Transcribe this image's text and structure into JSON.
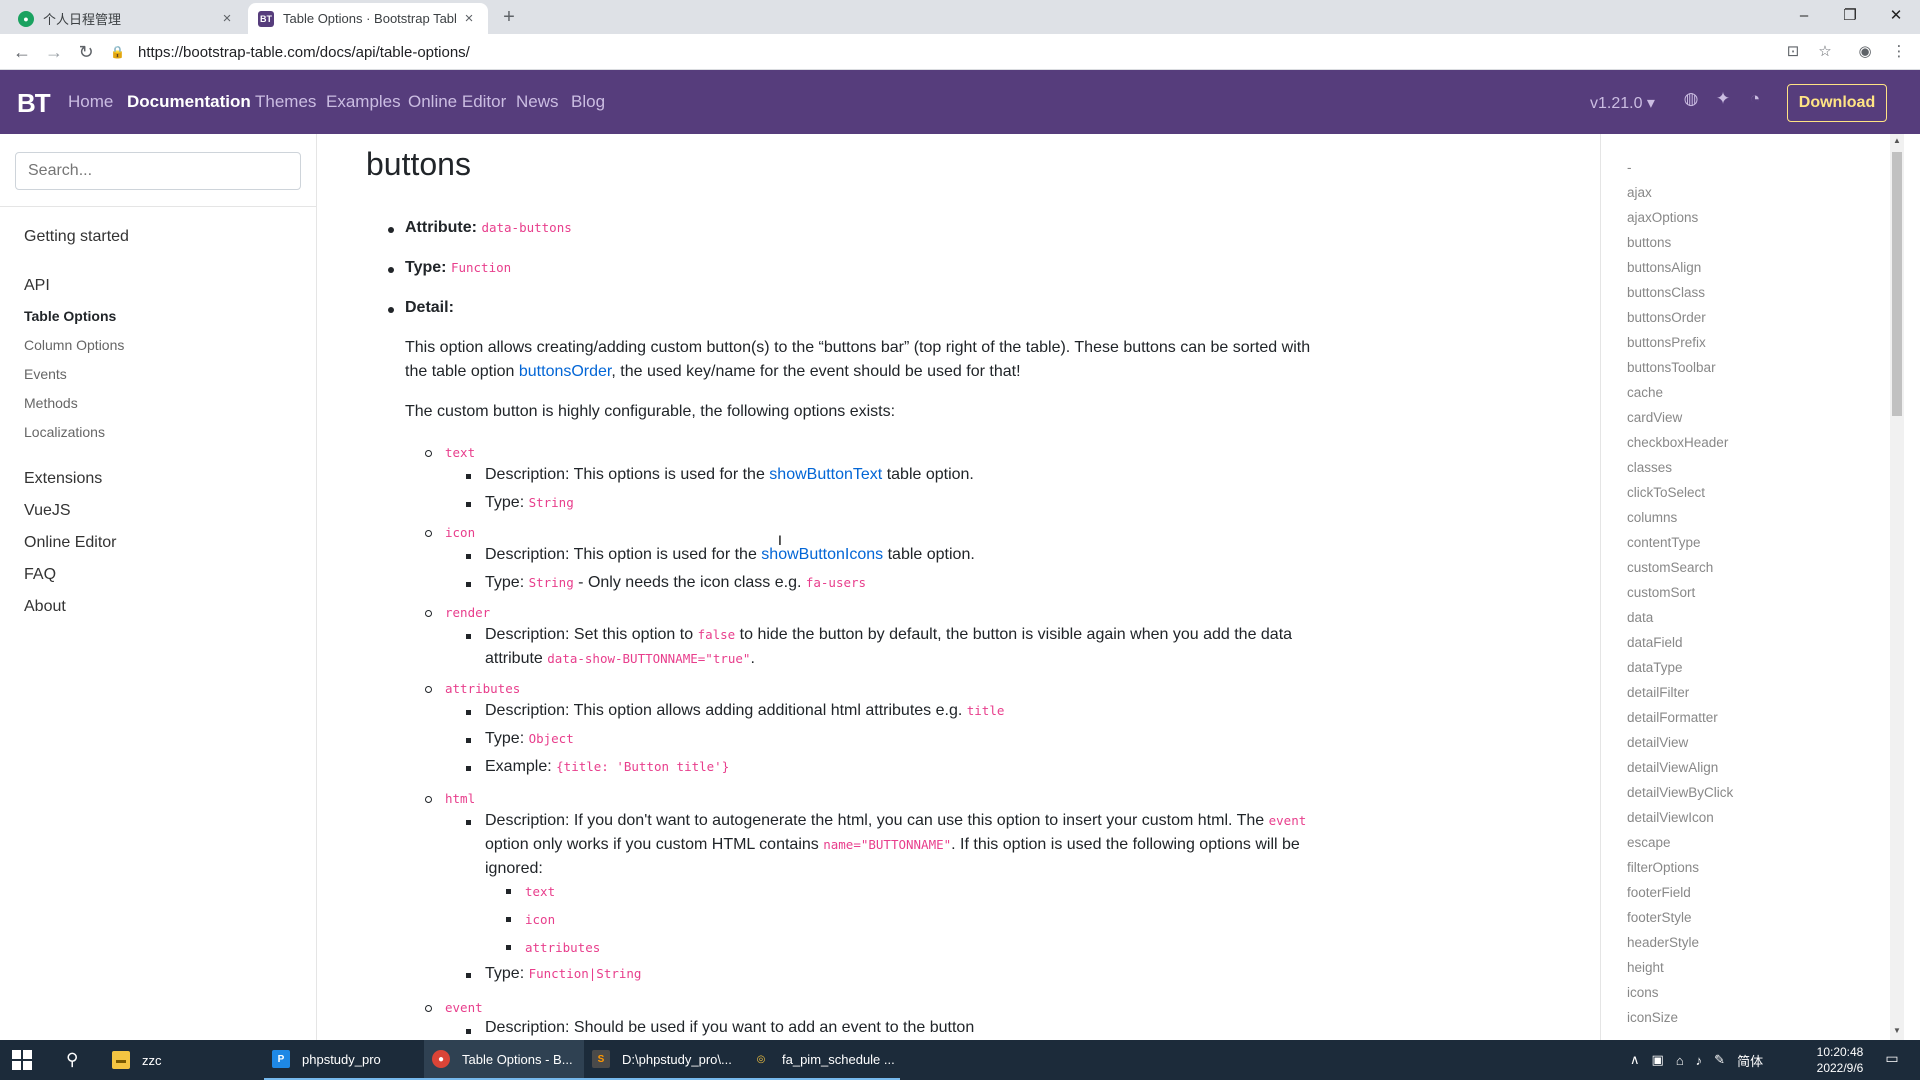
{
  "browser": {
    "tabs": [
      {
        "title": "个人日程管理",
        "close": "×"
      },
      {
        "title": "Table Options · Bootstrap Tabl",
        "close": "×"
      }
    ],
    "new_tab": "+",
    "url": "https://bootstrap-table.com/docs/api/table-options/",
    "window_controls": {
      "minimize": "–",
      "restore": "❐",
      "close": "✕"
    }
  },
  "navbar": {
    "brand": "BT",
    "links": [
      "Home",
      "Documentation",
      "Themes",
      "Examples",
      "Online Editor",
      "News",
      "Blog"
    ],
    "current_link": "Documentation",
    "version": "v1.21.0 ▾",
    "download": "Download"
  },
  "sidebar": {
    "search_placeholder": "Search...",
    "getting_started": "Getting started",
    "api": "API",
    "api_items": [
      "Table Options",
      "Column Options",
      "Events",
      "Methods",
      "Localizations"
    ],
    "groups": [
      "Extensions",
      "VueJS",
      "Online Editor",
      "FAQ",
      "About"
    ]
  },
  "content": {
    "title": "buttons",
    "attribute_label": "Attribute:",
    "attribute_value": "data-buttons",
    "type_label": "Type:",
    "type_value": "Function",
    "detail_label": "Detail:",
    "detail_p1a": "This option allows creating/adding custom button(s) to the “buttons bar” (top right of the table). These buttons can be sorted with",
    "detail_p1b_pre": "the table option ",
    "detail_p1b_link": "buttonsOrder",
    "detail_p1b_post": ", the used key/name for the event should be used for that!",
    "detail_p2": "The custom button is highly configurable, the following options exists:",
    "options": {
      "text": {
        "name": "text",
        "desc_pre": "Description: This options is used for the ",
        "desc_link": "showButtonText",
        "desc_post": " table option.",
        "type_pre": "Type: ",
        "type_code": "String"
      },
      "icon": {
        "name": "icon",
        "desc_pre": "Description: This option is used for the ",
        "desc_link": "showButtonIcons",
        "desc_post": " table option.",
        "type_pre": "Type: ",
        "type_code": "String",
        "type_mid": " - Only needs the icon class e.g. ",
        "type_code2": "fa-users"
      },
      "render": {
        "name": "render",
        "desc_pre": "Description: Set this option to ",
        "desc_code": "false",
        "desc_post": " to hide the button by default, the button is visible again when you add the data",
        "line2_pre": "attribute ",
        "line2_code": "data-show-BUTTONNAME=\"true\"",
        "line2_post": "."
      },
      "attributes": {
        "name": "attributes",
        "desc_pre": "Description: This option allows adding additional html attributes e.g. ",
        "desc_code": "title",
        "type_pre": "Type: ",
        "type_code": "Object",
        "example_pre": "Example: ",
        "example_code": "{title: 'Button title'}"
      },
      "html": {
        "name": "html",
        "desc_pre": "Description: If you don't want to autogenerate the html, you can use this option to insert your custom html. The ",
        "desc_code": "event",
        "line2_pre": "option only works if you custom HTML contains ",
        "line2_code": "name=\"BUTTONNAME\"",
        "line2_post": ". If this option is used the following options will be",
        "line3": "ignored:",
        "ignored": [
          "text",
          "icon",
          "attributes"
        ],
        "type_pre": "Type: ",
        "type_code": "Function|String"
      },
      "event": {
        "name": "event",
        "desc": "Description: Should be used if you want to add an event to the button"
      }
    }
  },
  "toc": [
    "-",
    "ajax",
    "ajaxOptions",
    "buttons",
    "buttonsAlign",
    "buttonsClass",
    "buttonsOrder",
    "buttonsPrefix",
    "buttonsToolbar",
    "cache",
    "cardView",
    "checkboxHeader",
    "classes",
    "clickToSelect",
    "columns",
    "contentType",
    "customSearch",
    "customSort",
    "data",
    "dataField",
    "dataType",
    "detailFilter",
    "detailFormatter",
    "detailView",
    "detailViewAlign",
    "detailViewByClick",
    "detailViewIcon",
    "escape",
    "filterOptions",
    "footerField",
    "footerStyle",
    "headerStyle",
    "height",
    "icons",
    "iconSize"
  ],
  "taskbar": {
    "items": [
      "zzc",
      "phpstudy_pro",
      "Table Options - B...",
      "D:\\phpstudy_pro\\...",
      "fa_pim_schedule ..."
    ],
    "ime": "简体",
    "time": "10:20:48",
    "date": "2022/9/6"
  },
  "colors": {
    "navbar_bg": "#563d7c",
    "download_accent": "#ffe484",
    "link": "#0366d6",
    "code": "#e83e8c"
  }
}
